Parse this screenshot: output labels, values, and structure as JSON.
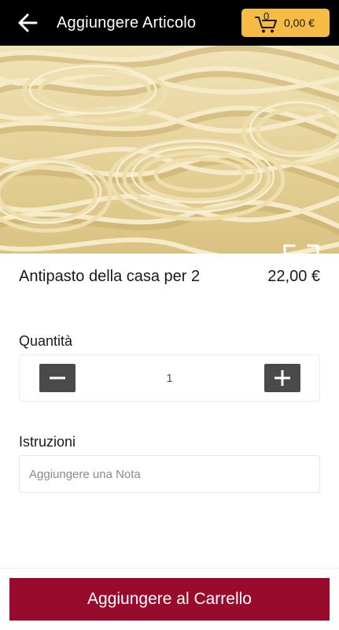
{
  "header": {
    "title": "Aggiungere Articolo",
    "back_icon": "arrow-left-icon",
    "cart": {
      "icon": "cart-icon",
      "count": "0",
      "total": "0,00 €",
      "color": "#f5bb45"
    },
    "background": "#000000"
  },
  "hero": {
    "image_subject": "fresh pasta nests",
    "expand_icon": "expand-icon"
  },
  "item": {
    "name": "Antipasto della casa per 2",
    "price": "22,00 €"
  },
  "quantity": {
    "label": "Quantità",
    "value": "1",
    "minus_icon": "minus-icon",
    "plus_icon": "plus-icon"
  },
  "notes": {
    "label": "Istruzioni",
    "placeholder": "Aggiungere una Nota",
    "value": ""
  },
  "footer": {
    "add_button_label": "Aggiungere al Carrello",
    "button_color": "#980b2c"
  }
}
